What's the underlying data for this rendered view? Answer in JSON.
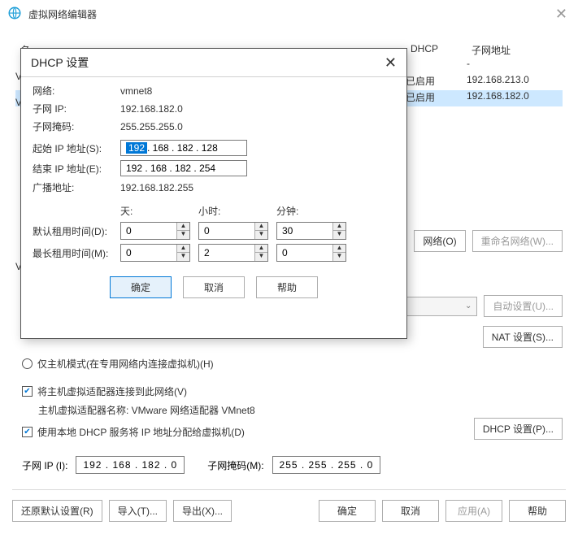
{
  "main": {
    "title": "虚拟网络编辑器",
    "close_glyph": "✕"
  },
  "table": {
    "header_name": "名",
    "header_dhcp": "DHCP",
    "header_subnet": "子网地址",
    "rows": [
      {
        "dhcp": "",
        "subnet": "-"
      },
      {
        "dhcp": "已启用",
        "subnet": "192.168.213.0"
      },
      {
        "dhcp": "已启用",
        "subnet": "192.168.182.0"
      }
    ]
  },
  "side": {
    "network_o": "网络(O)",
    "rename_w": "重命名网络(W)...",
    "auto_u": "自动设置(U)...",
    "nat_s": "NAT 设置(S)...",
    "dhcp_p": "DHCP 设置(P)..."
  },
  "vlabels": {
    "v1": "V",
    "v2": "V",
    "v3": "V"
  },
  "options": {
    "hostonly": "仅主机模式(在专用网络内连接虚拟机)(H)",
    "connect_adapter": "将主机虚拟适配器连接到此网络(V)",
    "adapter_name": "主机虚拟适配器名称: VMware 网络适配器 VMnet8",
    "use_local_dhcp": "使用本地 DHCP 服务将 IP 地址分配给虚拟机(D)"
  },
  "subnet": {
    "ip_label": "子网 IP (I):",
    "ip_value": "192 . 168 . 182 .  0",
    "mask_label": "子网掩码(M):",
    "mask_value": "255 . 255 . 255 .  0"
  },
  "bottom": {
    "restore": "还原默认设置(R)",
    "import": "导入(T)...",
    "export": "导出(X)...",
    "ok": "确定",
    "cancel": "取消",
    "apply": "应用(A)",
    "help": "帮助"
  },
  "dialog": {
    "title": "DHCP 设置",
    "close_glyph": "✕",
    "network_label": "网络:",
    "network_value": "vmnet8",
    "subnet_ip_label": "子网 IP:",
    "subnet_ip_value": "192.168.182.0",
    "mask_label": "子网掩码:",
    "mask_value": "255.255.255.0",
    "start_label": "起始 IP 地址(S):",
    "start_seg1": "192",
    "start_seg_rest": ". 168 . 182 . 128",
    "end_label": "结束 IP 地址(E):",
    "end_value": "192 . 168 . 182 . 254",
    "broadcast_label": "广播地址:",
    "broadcast_value": "192.168.182.255",
    "days": "天:",
    "hours": "小时:",
    "minutes": "分钟:",
    "default_lease": "默认租用时间(D):",
    "max_lease": "最长租用时间(M):",
    "dd": "0",
    "dh": "0",
    "dm": "30",
    "md": "0",
    "mh": "2",
    "mm": "0",
    "ok": "确定",
    "cancel": "取消",
    "help": "帮助"
  },
  "combo_chevron": "⌄"
}
